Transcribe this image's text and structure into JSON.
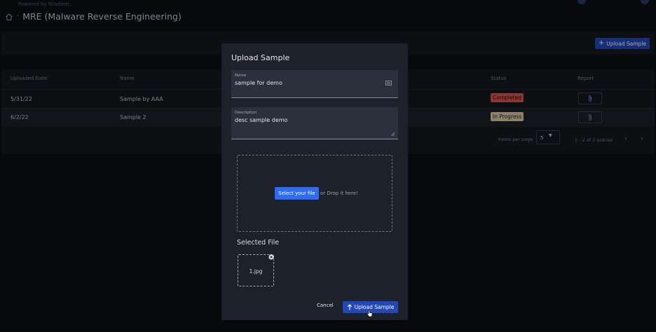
{
  "app": {
    "powered_by": "Powered by Gradient.",
    "title": "MRE (Malware Reverse Engineering)"
  },
  "toolbar": {
    "upload_label": "Upload Sample"
  },
  "table": {
    "headers": [
      "Uploaded Date",
      "Name",
      "Status",
      "Report"
    ],
    "rows": [
      {
        "date": "5/31/22",
        "name": "Sample by AAA",
        "status": "Completed"
      },
      {
        "date": "6/2/22",
        "name": "Sample 2",
        "status": "In Progress"
      }
    ]
  },
  "pagination": {
    "items_per_page_label": "Items per page:",
    "items_per_page": "5",
    "range": "1 - 2 of 2 entries"
  },
  "modal": {
    "title": "Upload Sample",
    "name_label": "Name",
    "name_value": "sample for demo",
    "description_label": "Description",
    "description_value": "desc sample demo",
    "select_file_label": "Select your file",
    "drop_text": "or Drop it here!",
    "selected_file_heading": "Selected File",
    "selected_file_name": "1.jpg",
    "cancel_label": "Cancel",
    "upload_label": "Upload Sample"
  },
  "colors": {
    "primary": "#2447b8",
    "completed": "#d9534f",
    "in_progress": "#d8c9a8"
  }
}
